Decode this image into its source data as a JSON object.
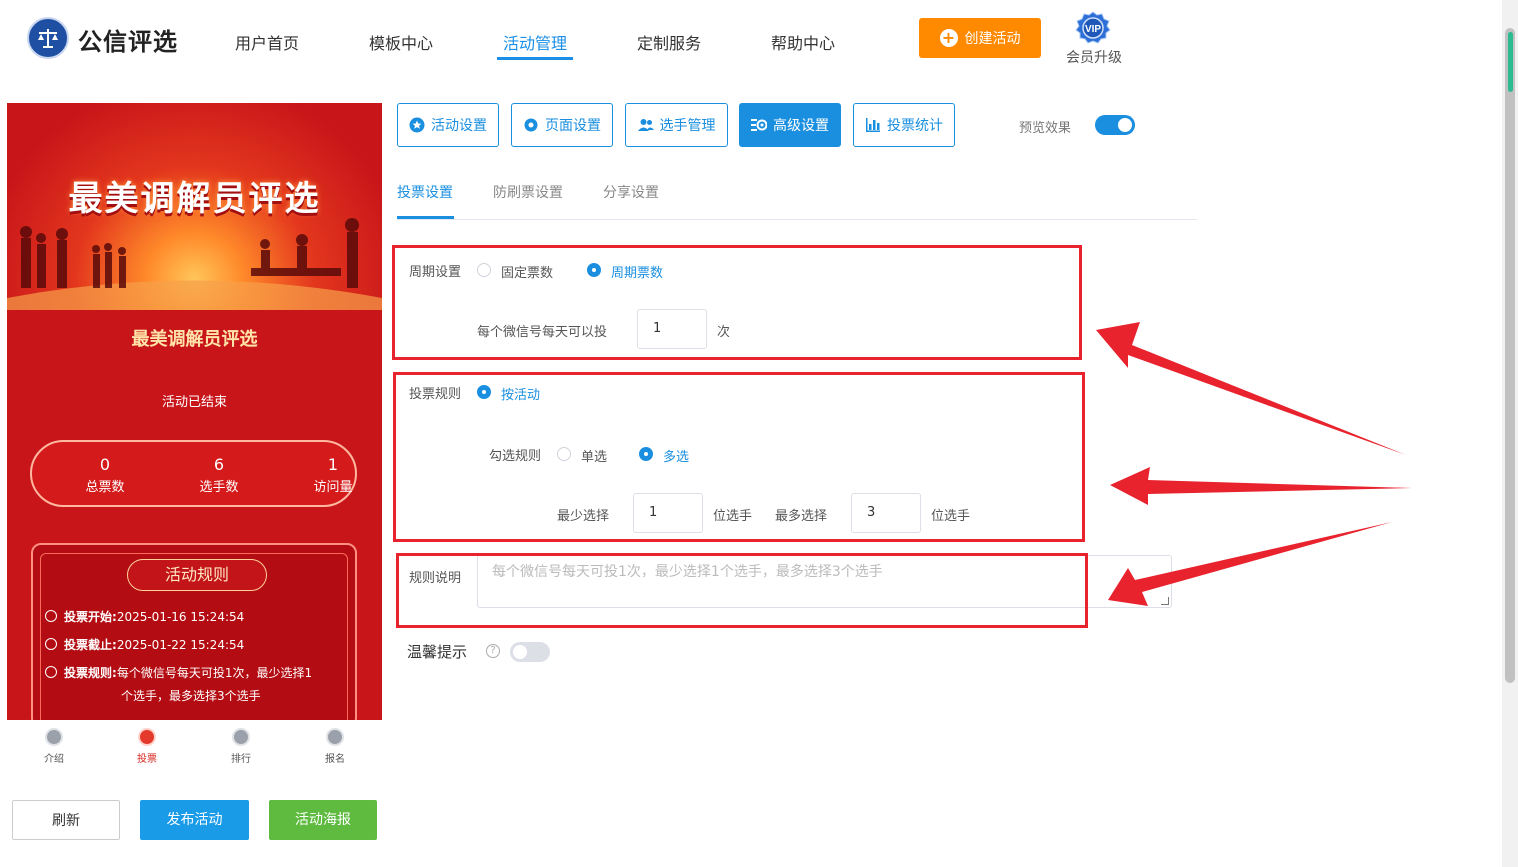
{
  "header": {
    "logo_text": "公信评选",
    "nav": [
      "用户首页",
      "模板中心",
      "活动管理",
      "定制服务",
      "帮助中心"
    ],
    "active_nav": "活动管理",
    "create_button": "创建活动",
    "vip_badge": "VIP",
    "vip_label": "会员升级"
  },
  "preview": {
    "banner_title": "最美调解员评选",
    "title": "最美调解员评选",
    "status": "活动已结束",
    "stats": [
      {
        "value": "0",
        "label": "总票数"
      },
      {
        "value": "6",
        "label": "选手数"
      },
      {
        "value": "1",
        "label": "访问量"
      }
    ],
    "rules_title": "活动规则",
    "vote_start_label": "投票开始:",
    "vote_start": "2025-01-16 15:24:54",
    "vote_end_label": "投票截止:",
    "vote_end": "2025-01-22 15:24:54",
    "vote_rule_label": "投票规则:",
    "vote_rule_1": "每个微信号每天可投1次，最少选择1",
    "vote_rule_2": "个选手，最多选择3个选手",
    "bottom_nav": [
      "介绍",
      "投票",
      "排行",
      "报名"
    ],
    "bottom_nav_active": "投票"
  },
  "actions": {
    "refresh": "刷新",
    "publish": "发布活动",
    "poster": "活动海报"
  },
  "toolbar": {
    "buttons": [
      "活动设置",
      "页面设置",
      "选手管理",
      "高级设置",
      "投票统计"
    ],
    "active": "高级设置",
    "preview_label": "预览效果",
    "preview_on": true
  },
  "subtabs": {
    "items": [
      "投票设置",
      "防刷票设置",
      "分享设置"
    ],
    "active": "投票设置"
  },
  "form": {
    "period_label": "周期设置",
    "period_options": [
      "固定票数",
      "周期票数"
    ],
    "period_selected": "周期票数",
    "daily_label": "每个微信号每天可以投",
    "daily_value": "1",
    "daily_unit": "次",
    "rule_label": "投票规则",
    "rule_option": "按活动",
    "select_label": "勾选规则",
    "select_options": [
      "单选",
      "多选"
    ],
    "select_selected": "多选",
    "min_label": "最少选择",
    "min_value": "1",
    "min_unit": "位选手",
    "max_label": "最多选择",
    "max_value": "3",
    "max_unit": "位选手",
    "desc_label": "规则说明",
    "desc_placeholder": "每个微信号每天可投1次，最少选择1个选手，最多选择3个选手",
    "tip_label": "温馨提示",
    "tip_help": "?",
    "tip_enabled": false
  },
  "colors": {
    "accent": "#1a8fe0",
    "orange": "#ff8a00",
    "annotation_red": "#e8232e",
    "preview_red": "#c8151a"
  }
}
